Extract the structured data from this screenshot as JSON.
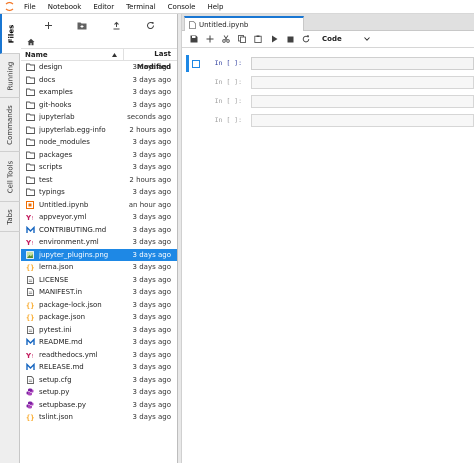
{
  "menu": [
    "File",
    "Notebook",
    "Editor",
    "Terminal",
    "Console",
    "Help"
  ],
  "sidetabs": [
    "Files",
    "Running",
    "Commands",
    "Cell Tools",
    "Tabs"
  ],
  "filebrowser": {
    "header": {
      "name": "Name",
      "modified": "Last Modified"
    },
    "rows": [
      {
        "name": "design",
        "modified": "3 days ago",
        "icon": "folder-icon"
      },
      {
        "name": "docs",
        "modified": "3 days ago",
        "icon": "folder-icon"
      },
      {
        "name": "examples",
        "modified": "3 days ago",
        "icon": "folder-icon"
      },
      {
        "name": "git-hooks",
        "modified": "3 days ago",
        "icon": "folder-icon"
      },
      {
        "name": "jupyterlab",
        "modified": "seconds ago",
        "icon": "folder-icon"
      },
      {
        "name": "jupyterlab.egg-info",
        "modified": "2 hours ago",
        "icon": "folder-icon"
      },
      {
        "name": "node_modules",
        "modified": "3 days ago",
        "icon": "folder-icon"
      },
      {
        "name": "packages",
        "modified": "3 days ago",
        "icon": "folder-icon"
      },
      {
        "name": "scripts",
        "modified": "3 days ago",
        "icon": "folder-icon"
      },
      {
        "name": "test",
        "modified": "2 hours ago",
        "icon": "folder-icon"
      },
      {
        "name": "typings",
        "modified": "3 days ago",
        "icon": "folder-icon"
      },
      {
        "name": "Untitled.ipynb",
        "modified": "an hour ago",
        "icon": "notebook-icon"
      },
      {
        "name": "appveyor.yml",
        "modified": "3 days ago",
        "icon": "yaml-icon"
      },
      {
        "name": "CONTRIBUTING.md",
        "modified": "3 days ago",
        "icon": "markdown-icon"
      },
      {
        "name": "environment.yml",
        "modified": "3 days ago",
        "icon": "yaml-icon"
      },
      {
        "name": "jupyter_plugins.png",
        "modified": "3 days ago",
        "icon": "image-icon",
        "selected": true
      },
      {
        "name": "lerna.json",
        "modified": "3 days ago",
        "icon": "json-icon"
      },
      {
        "name": "LICENSE",
        "modified": "3 days ago",
        "icon": "file-icon"
      },
      {
        "name": "MANIFEST.in",
        "modified": "3 days ago",
        "icon": "file-icon"
      },
      {
        "name": "package-lock.json",
        "modified": "3 days ago",
        "icon": "json-icon"
      },
      {
        "name": "package.json",
        "modified": "3 days ago",
        "icon": "json-icon"
      },
      {
        "name": "pytest.ini",
        "modified": "3 days ago",
        "icon": "file-icon"
      },
      {
        "name": "README.md",
        "modified": "3 days ago",
        "icon": "markdown-icon"
      },
      {
        "name": "readthedocs.yml",
        "modified": "3 days ago",
        "icon": "yaml-icon"
      },
      {
        "name": "RELEASE.md",
        "modified": "3 days ago",
        "icon": "markdown-icon"
      },
      {
        "name": "setup.cfg",
        "modified": "3 days ago",
        "icon": "file-icon"
      },
      {
        "name": "setup.py",
        "modified": "3 days ago",
        "icon": "python-icon"
      },
      {
        "name": "setupbase.py",
        "modified": "3 days ago",
        "icon": "python-icon"
      },
      {
        "name": "tslint.json",
        "modified": "3 days ago",
        "icon": "json-icon"
      }
    ]
  },
  "notebook": {
    "tab_title": "Untitled.ipynb",
    "cell_type": "Code",
    "cells": [
      {
        "prompt": "In [ ]:",
        "active": true
      },
      {
        "prompt": "In [ ]:",
        "active": false
      },
      {
        "prompt": "In [ ]:",
        "active": false
      },
      {
        "prompt": "In [ ]:",
        "active": false
      }
    ]
  },
  "colors": {
    "accent": "#1e88e5",
    "folder": "#5f6368",
    "yaml": "#c2185b",
    "markdown": "#1565c0",
    "json": "#f9a825",
    "python": "#7b1fa2",
    "notebook": "#ef6c00"
  }
}
